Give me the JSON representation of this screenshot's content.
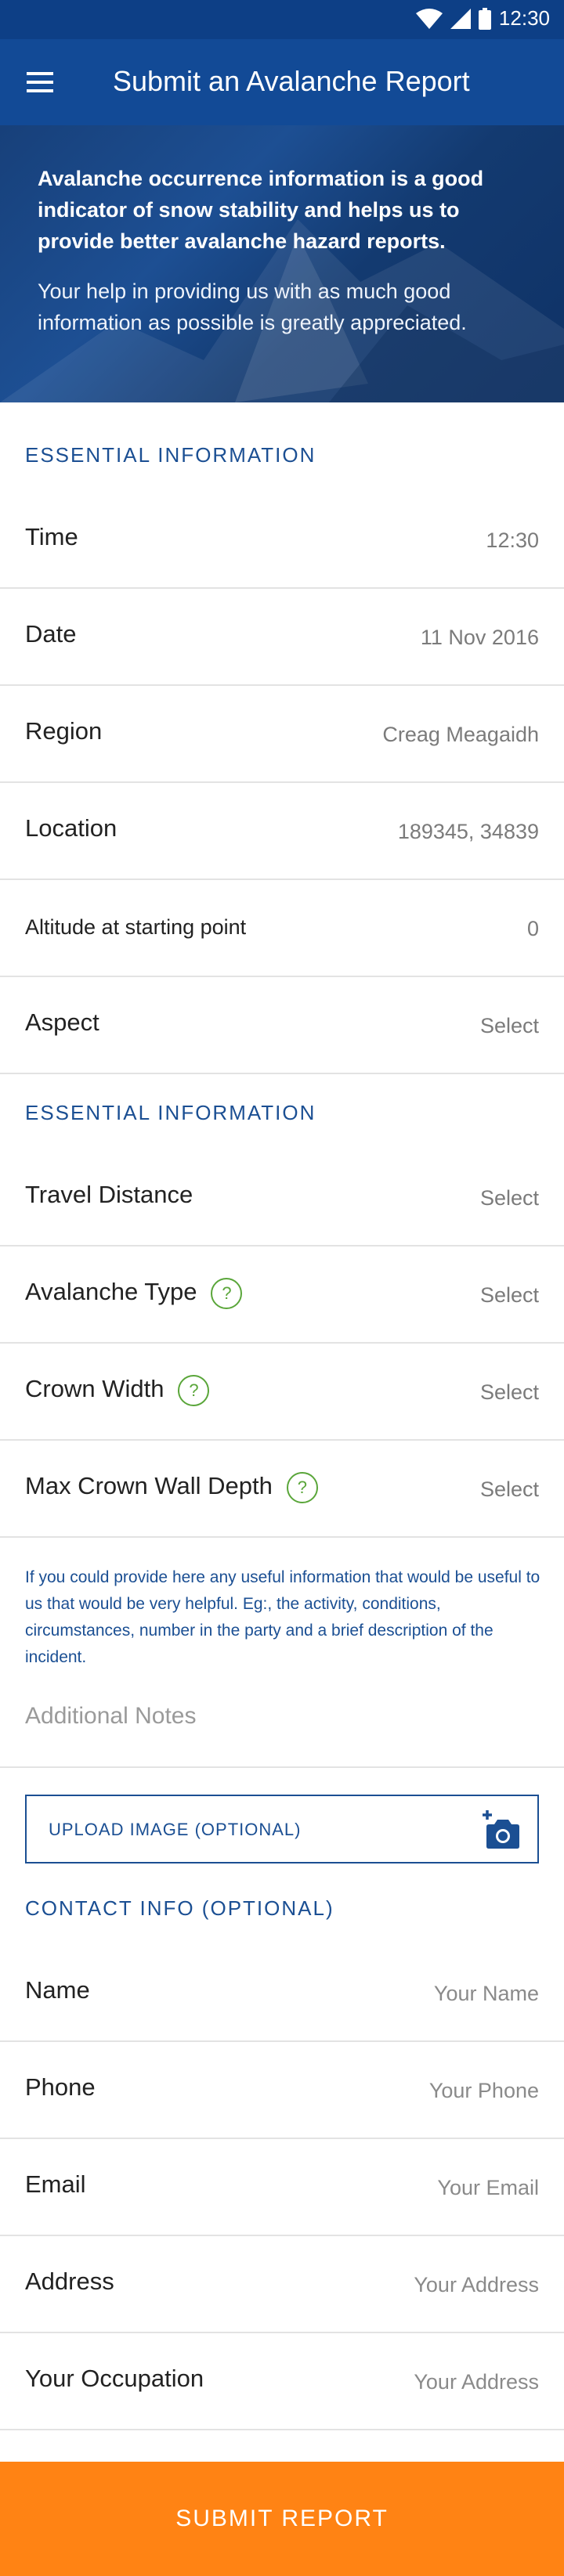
{
  "status_bar": {
    "time": "12:30"
  },
  "app_bar": {
    "title": "Submit an Avalanche Report"
  },
  "hero": {
    "intro": "Avalanche occurrence information is a good indicator of snow stability and helps us to provide better avalanche hazard reports.",
    "thanks": "Your help in providing us with as much good information as possible is greatly appreciated."
  },
  "section1": {
    "heading": "ESSENTIAL INFORMATION",
    "rows": [
      {
        "label": "Time",
        "value": "12:30"
      },
      {
        "label": "Date",
        "value": "11 Nov 2016"
      },
      {
        "label": "Region",
        "value": "Creag Meagaidh"
      },
      {
        "label": "Location",
        "value": "189345, 34839"
      },
      {
        "label": "Altitude at starting point",
        "value": "0"
      },
      {
        "label": "Aspect",
        "value": "Select"
      }
    ]
  },
  "section2": {
    "heading": "ESSENTIAL INFORMATION",
    "rows": [
      {
        "label": "Travel Distance",
        "value": "Select"
      },
      {
        "label": "Avalanche Type",
        "value": "Select",
        "help": "?"
      },
      {
        "label": "Crown Width",
        "value": "Select",
        "help": "?"
      },
      {
        "label": "Max Crown Wall Depth",
        "value": "Select",
        "help": "?"
      }
    ],
    "note": "If you could provide here any useful information that would be useful to us that would be very helpful. Eg:, the activity, conditions, circumstances, number in the party and a brief description of the incident.",
    "notes_placeholder": "Additional Notes",
    "upload_label": "UPLOAD IMAGE (OPTIONAL)"
  },
  "contact": {
    "heading": "CONTACT INFO (OPTIONAL)",
    "rows": [
      {
        "label": "Name",
        "placeholder": "Your Name"
      },
      {
        "label": "Phone",
        "placeholder": "Your Phone"
      },
      {
        "label": "Email",
        "placeholder": "Your Email"
      },
      {
        "label": "Address",
        "placeholder": "Your Address"
      },
      {
        "label": "Your Occupation",
        "placeholder": "Your Address"
      }
    ]
  },
  "submit_label": "SUBMIT REPORT",
  "colors": {
    "primary": "#124a96",
    "accent": "#ff8314",
    "help": "#5aa63a"
  }
}
